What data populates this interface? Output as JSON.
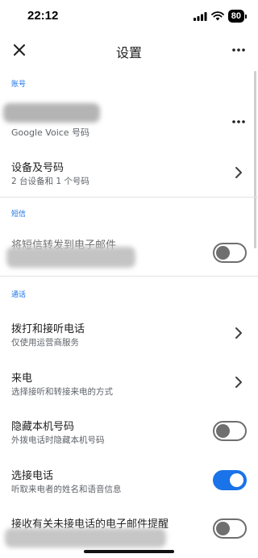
{
  "status_bar": {
    "time": "22:12",
    "battery": "80"
  },
  "app_bar": {
    "title": "设置"
  },
  "sections": {
    "account": {
      "label": "账号",
      "google_voice_number_sub": "Google Voice 号码",
      "devices_title": "设备及号码",
      "devices_sub": "2 台设备和 1 个号码"
    },
    "sms": {
      "label": "短信",
      "forward_title": "将短信转发到电子邮件",
      "forward_enabled": false
    },
    "calls": {
      "label": "通话",
      "make_receive_title": "拨打和接听电话",
      "make_receive_sub": "仅使用运营商服务",
      "incoming_title": "来电",
      "incoming_sub": "选择接听和转接来电的方式",
      "hide_number_title": "隐藏本机号码",
      "hide_number_sub": "外拨电话时隐藏本机号码",
      "hide_number_enabled": false,
      "screen_calls_title": "选接电话",
      "screen_calls_sub": "听取来电者的姓名和语音信息",
      "screen_calls_enabled": true,
      "missed_email_title": "接收有关未接电话的电子邮件提醒",
      "missed_email_enabled": false
    }
  }
}
